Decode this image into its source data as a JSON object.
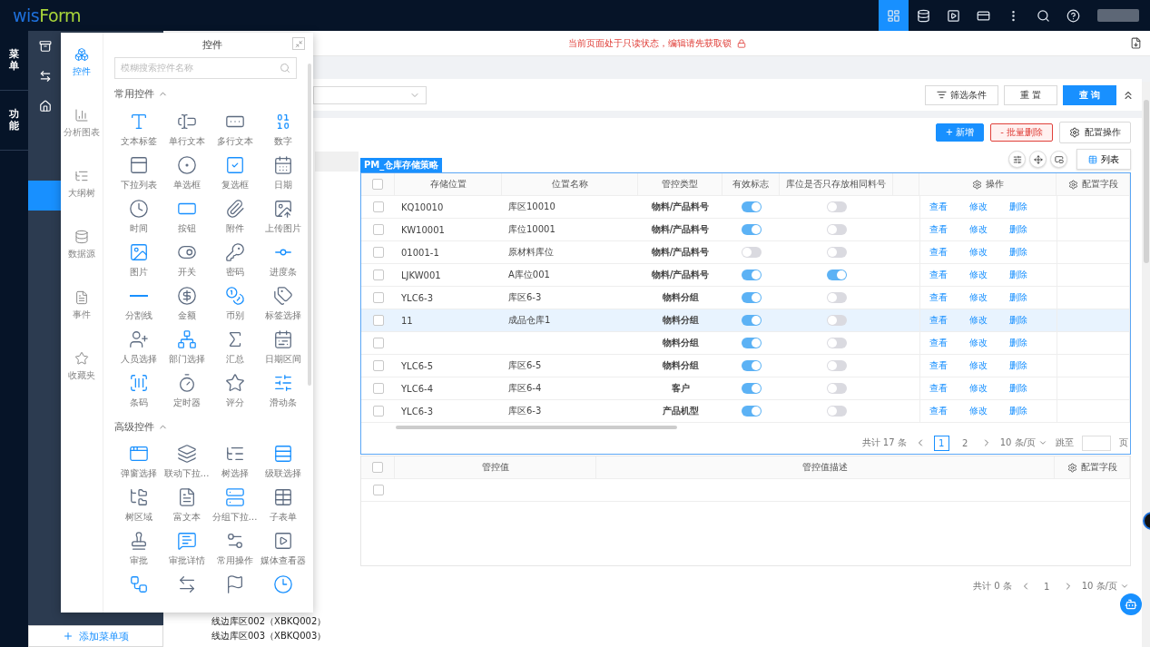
{
  "topbar": {
    "logo": {
      "prefix": "wis",
      "suffix": "Form"
    },
    "tools": [
      {
        "selected": true
      },
      {
        "selected": false
      },
      {
        "selected": false
      },
      {
        "selected": false
      },
      {
        "selected": false
      },
      {
        "selected": false
      },
      {
        "selected": false
      }
    ]
  },
  "rail": [
    {
      "label": "菜单"
    },
    {
      "label": "功能"
    }
  ],
  "sidebar": {
    "items": [
      {
        "selected": false
      },
      {
        "selected": false
      },
      {
        "selected": false
      },
      {
        "selected": false
      },
      {
        "selected": false
      },
      {
        "selected": true
      }
    ],
    "add_button": "添加菜单项"
  },
  "palette": {
    "title": "控件",
    "tabs": [
      {
        "label": "控件",
        "selected": true
      },
      {
        "label": "分析图表",
        "selected": false
      },
      {
        "label": "大纲树",
        "selected": false
      },
      {
        "label": "数据源",
        "selected": false
      },
      {
        "label": "事件",
        "selected": false
      },
      {
        "label": "收藏夹",
        "selected": false
      }
    ],
    "search": {
      "placeholder": "模糊搜索控件名称"
    },
    "sections": [
      {
        "title": "常用控件",
        "expanded": true,
        "items": [
          {
            "kind": "tile",
            "label": "文本标签"
          },
          {
            "kind": "tile",
            "label": "单行文本"
          },
          {
            "kind": "tile",
            "label": "多行文本"
          },
          {
            "kind": "tile",
            "label": "数字"
          },
          {
            "kind": "tile",
            "label": "下拉列表"
          },
          {
            "kind": "tile",
            "label": "单选框"
          },
          {
            "kind": "tile",
            "label": "复选框"
          },
          {
            "kind": "tile",
            "label": "日期"
          },
          {
            "kind": "tile",
            "label": "时间"
          },
          {
            "kind": "tile",
            "label": "按钮"
          },
          {
            "kind": "tile",
            "label": "附件"
          },
          {
            "kind": "tile",
            "label": "上传图片"
          },
          {
            "kind": "tile",
            "label": "图片"
          },
          {
            "kind": "tile",
            "label": "开关"
          },
          {
            "kind": "tile",
            "label": "密码"
          },
          {
            "kind": "tile",
            "label": "进度条"
          },
          {
            "kind": "tile",
            "label": "分割线"
          },
          {
            "kind": "tile",
            "label": "金额"
          },
          {
            "kind": "tile",
            "label": "币别"
          },
          {
            "kind": "tile",
            "label": "标签选择"
          },
          {
            "kind": "tile",
            "label": "人员选择"
          },
          {
            "kind": "tile",
            "label": "部门选择"
          },
          {
            "kind": "tile",
            "label": "汇总"
          },
          {
            "kind": "tile",
            "label": "日期区间"
          },
          {
            "kind": "tile",
            "label": "条码"
          },
          {
            "kind": "tile",
            "label": "定时器"
          },
          {
            "kind": "tile",
            "label": "评分"
          },
          {
            "kind": "tile",
            "label": "滑动条"
          }
        ]
      },
      {
        "title": "高级控件",
        "expanded": true,
        "items": [
          {
            "kind": "tile",
            "label": "弹窗选择"
          },
          {
            "kind": "tile",
            "label": "联动下拉…"
          },
          {
            "kind": "tile",
            "label": "树选择"
          },
          {
            "kind": "tile",
            "label": "级联选择"
          },
          {
            "kind": "tile",
            "label": "树区域"
          },
          {
            "kind": "tile",
            "label": "富文本"
          },
          {
            "kind": "tile",
            "label": "分组下拉…"
          },
          {
            "kind": "tile",
            "label": "子表单"
          },
          {
            "kind": "tile",
            "label": "审批"
          },
          {
            "kind": "tile",
            "label": "审批详情"
          },
          {
            "kind": "tile",
            "label": "常用操作"
          },
          {
            "kind": "tile",
            "label": "媒体查看器"
          },
          {
            "kind": "icon"
          },
          {
            "kind": "icon"
          },
          {
            "kind": "icon"
          },
          {
            "kind": "icon"
          }
        ]
      }
    ]
  },
  "notice": {
    "text": "当前页面处于只读状态，编辑请先获取锁"
  },
  "filter": {
    "buttons": [
      {
        "kind": "filter",
        "label": "筛选条件"
      },
      {
        "kind": "default",
        "label": "重 置"
      },
      {
        "kind": "primary",
        "label": "查 询"
      }
    ]
  },
  "actions": [
    {
      "kind": "primary",
      "label": "+ 新增"
    },
    {
      "kind": "danger",
      "label": "- 批量删除"
    },
    {
      "kind": "config",
      "label": "配置操作"
    }
  ],
  "tree": {
    "items": [
      {
        "label": "线边库区002（XBKQ002）"
      },
      {
        "label": "线边库区003（XBKQ003）"
      }
    ]
  },
  "main_table": {
    "tag": "PM_仓库存储策略",
    "view_button": "列表",
    "header_checked": false,
    "columns": [
      "存储位置",
      "位置名称",
      "管控类型",
      "有效标志",
      "库位是否只存放相同料号"
    ],
    "action_header": "操作",
    "config_header": "配置字段",
    "rows": [
      {
        "checked": false,
        "selected": false,
        "code": "KQ10010",
        "name": "库区10010",
        "control_type": "物料/产品料号",
        "effective": true,
        "same_part_only": false,
        "actions": [
          "查看",
          "修改",
          "删除"
        ]
      },
      {
        "checked": false,
        "selected": false,
        "code": "KW10001",
        "name": "库位10001",
        "control_type": "物料/产品料号",
        "effective": true,
        "same_part_only": false,
        "actions": [
          "查看",
          "修改",
          "删除"
        ]
      },
      {
        "checked": false,
        "selected": false,
        "code": "01001-1",
        "name": "原材料库位",
        "control_type": "物料/产品料号",
        "effective": false,
        "same_part_only": false,
        "actions": [
          "查看",
          "修改",
          "删除"
        ]
      },
      {
        "checked": false,
        "selected": false,
        "code": "LJKW001",
        "name": "A库位001",
        "control_type": "物料/产品料号",
        "effective": true,
        "same_part_only": true,
        "actions": [
          "查看",
          "修改",
          "删除"
        ]
      },
      {
        "checked": false,
        "selected": false,
        "code": "YLC6-3",
        "name": "库区6-3",
        "control_type": "物料分组",
        "effective": true,
        "same_part_only": false,
        "actions": [
          "查看",
          "修改",
          "删除"
        ]
      },
      {
        "checked": false,
        "selected": true,
        "code": "11",
        "name": "成品仓库1",
        "control_type": "物料分组",
        "effective": true,
        "same_part_only": false,
        "actions": [
          "查看",
          "修改",
          "删除"
        ]
      },
      {
        "checked": false,
        "selected": false,
        "control_type": "物料分组",
        "effective": true,
        "same_part_only": false,
        "actions": [
          "查看",
          "修改",
          "删除"
        ]
      },
      {
        "checked": false,
        "selected": false,
        "code": "YLC6-5",
        "name": "库区6-5",
        "control_type": "物料分组",
        "effective": true,
        "same_part_only": false,
        "actions": [
          "查看",
          "修改",
          "删除"
        ]
      },
      {
        "checked": false,
        "selected": false,
        "code": "YLC6-4",
        "name": "库区6-4",
        "control_type": "客户",
        "effective": true,
        "same_part_only": false,
        "actions": [
          "查看",
          "修改",
          "删除"
        ]
      },
      {
        "checked": false,
        "selected": false,
        "code": "YLC6-3",
        "name": "库区6-3",
        "control_type": "产品机型",
        "effective": true,
        "same_part_only": false,
        "actions": [
          "查看",
          "修改",
          "删除"
        ]
      }
    ],
    "pagination": {
      "total": "共计 17 条",
      "pages": [
        {
          "label": "1",
          "selected": true
        },
        {
          "label": "2",
          "selected": false
        }
      ],
      "page_size": "10 条/页",
      "jump_label": "跳至",
      "page_suffix": "页"
    }
  },
  "sub_table": {
    "header_checked": false,
    "columns": [
      "管控值",
      "管控值描述"
    ],
    "config_header": "配置字段",
    "rows": [
      {
        "checked": false
      }
    ],
    "pagination": {
      "total": "共计 0 条",
      "pages": [
        {
          "label": "1",
          "selected": false
        }
      ],
      "page_size": "10 条/页"
    }
  }
}
